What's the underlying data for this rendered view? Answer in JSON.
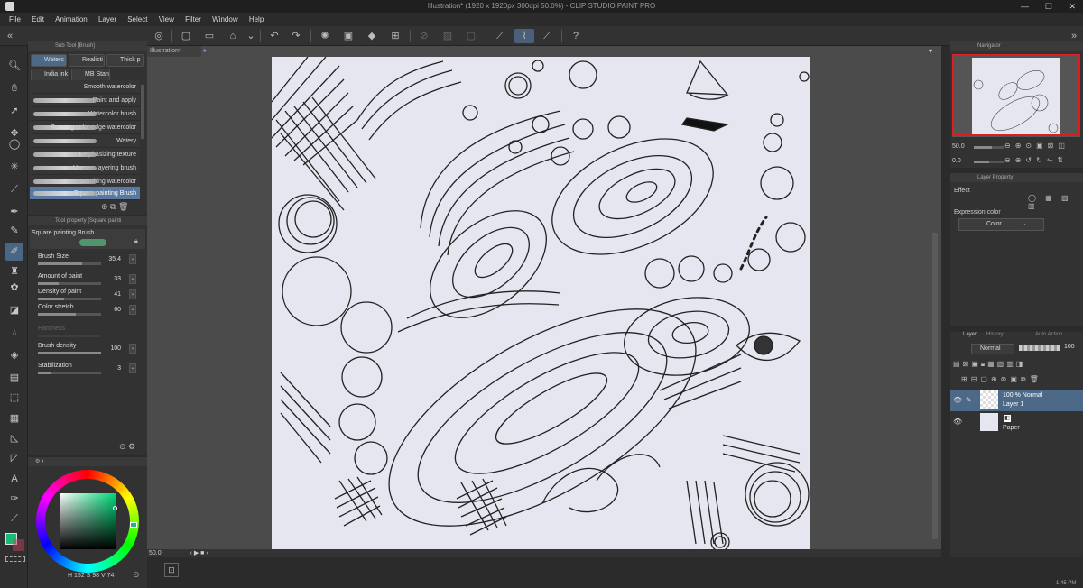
{
  "title": "Illustration* (1920 x 1920px 300dpi 50.0%) - CLIP STUDIO PAINT PRO",
  "menu": [
    "File",
    "Edit",
    "Animation",
    "Layer",
    "Select",
    "View",
    "Filter",
    "Window",
    "Help"
  ],
  "subtool": {
    "header": "Sub Tool [Brush]",
    "tabs": [
      "Waterc",
      "Realisti",
      "Thick p",
      "India ink",
      "MB Stan"
    ],
    "brushes": [
      "Smooth watercolor",
      "Paint and apply",
      "Watercolor brush",
      "Running color edge watercolor",
      "Watery",
      "Emphasizing texture",
      "Uneven layering brush",
      "Soothing watercolor",
      "Square painting Brush"
    ]
  },
  "toolprop": {
    "header": "Tool property [Square painti",
    "brush_name": "Square painting Brush",
    "props": [
      {
        "label": "Brush Size",
        "value": "35.4",
        "fill": 0.7
      },
      {
        "label": "Amount of paint",
        "value": "33",
        "fill": 0.33
      },
      {
        "label": "Density of paint",
        "value": "41",
        "fill": 0.41
      },
      {
        "label": "Color stretch",
        "value": "60",
        "fill": 0.6
      },
      {
        "label": "Hardness",
        "value": "",
        "fill": 0
      },
      {
        "label": "Brush density",
        "value": "100",
        "fill": 1
      },
      {
        "label": "Stabilization",
        "value": "3",
        "fill": 0.2
      }
    ]
  },
  "color": {
    "h": "152",
    "s": "98",
    "v": "74",
    "main": "#1db874",
    "accent": "#2fae6c"
  },
  "canvas": {
    "doc_tab": "Illustration*",
    "zoom": "50.0"
  },
  "navigator": {
    "header": "Navigator",
    "zoom": "50.0",
    "angle": "0.0"
  },
  "layer_property": {
    "header": "Layer Property",
    "effect": "Effect",
    "expr_label": "Expression color",
    "expr_value": "Color"
  },
  "layers": {
    "tabs": [
      "Layer",
      "History",
      "Auto Action"
    ],
    "blend": "Normal",
    "opacity": "100",
    "items": [
      {
        "name": "Layer 1",
        "mode": "100 % Normal",
        "selected": true
      },
      {
        "name": "Paper",
        "mode": "",
        "selected": false
      }
    ]
  },
  "clock": "1:45 PM"
}
